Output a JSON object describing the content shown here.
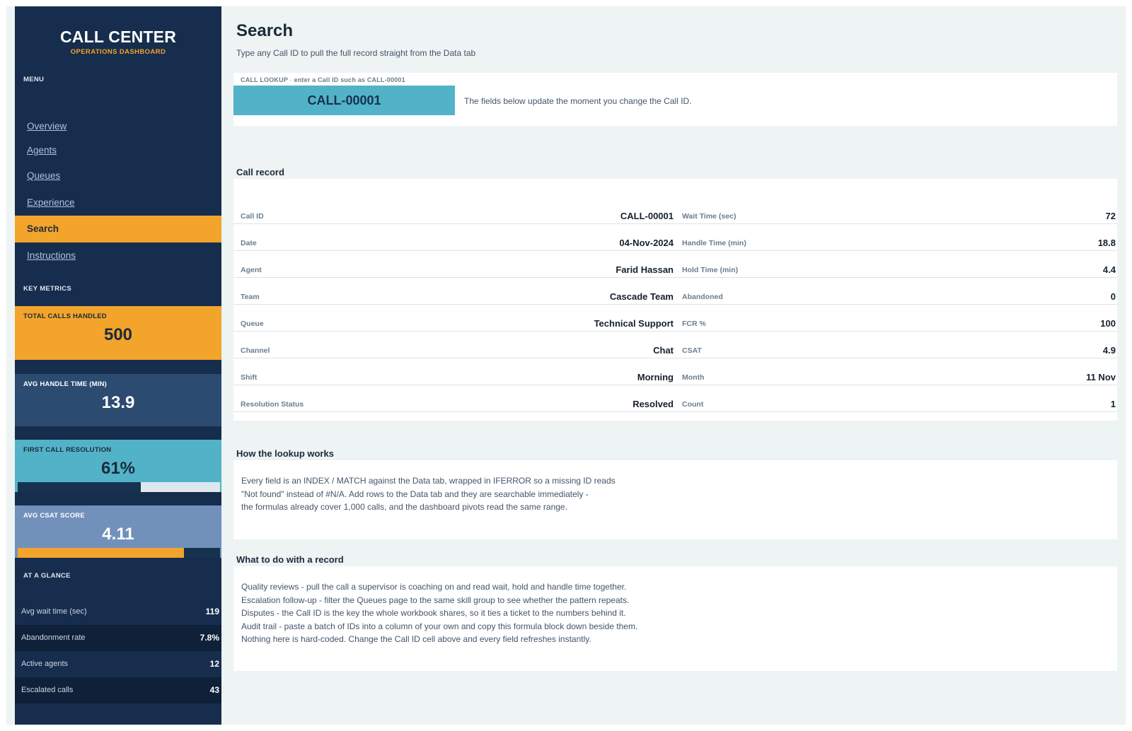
{
  "sidebar": {
    "title": "CALL CENTER",
    "subtitle": "OPERATIONS DASHBOARD",
    "menu_label": "MENU",
    "nav": [
      {
        "label": "Overview",
        "active": false
      },
      {
        "label": "Agents",
        "active": false
      },
      {
        "label": "Queues",
        "active": false
      },
      {
        "label": "Experience",
        "active": false
      },
      {
        "label": "Search",
        "active": true
      },
      {
        "label": "Instructions",
        "active": false
      }
    ],
    "metrics_label": "KEY METRICS",
    "metrics": [
      {
        "label": "TOTAL CALLS HANDLED",
        "value": "500"
      },
      {
        "label": "AVG HANDLE TIME (MIN)",
        "value": "13.9"
      },
      {
        "label": "FIRST CALL RESOLUTION",
        "value": "61%",
        "fraction": 0.61
      },
      {
        "label": "AVG CSAT SCORE",
        "value": "4.11",
        "fraction": 0.822
      }
    ],
    "glance_label": "AT A GLANCE",
    "glance": [
      {
        "label": "Avg wait time (sec)",
        "value": "119"
      },
      {
        "label": "Abandonment rate",
        "value": "7.8%"
      },
      {
        "label": "Active agents",
        "value": "12"
      },
      {
        "label": "Escalated calls",
        "value": "43"
      }
    ]
  },
  "main": {
    "title": "Search",
    "subtitle": "Type any Call ID to pull the full record straight from the Data tab",
    "lookup": {
      "label": "CALL LOOKUP",
      "separator": "·",
      "hint": "enter a Call ID such as CALL-00001",
      "value": "CALL-00001",
      "note": "The fields below update the moment you change the Call ID."
    },
    "record_title": "Call record",
    "record_left": [
      {
        "label": "Call ID",
        "value": "CALL-00001"
      },
      {
        "label": "Date",
        "value": "04-Nov-2024"
      },
      {
        "label": "Agent",
        "value": "Farid Hassan"
      },
      {
        "label": "Team",
        "value": "Cascade Team"
      },
      {
        "label": "Queue",
        "value": "Technical Support"
      },
      {
        "label": "Channel",
        "value": "Chat"
      },
      {
        "label": "Shift",
        "value": "Morning"
      },
      {
        "label": "Resolution Status",
        "value": "Resolved"
      }
    ],
    "record_right": [
      {
        "label": "Wait Time (sec)",
        "value": "72"
      },
      {
        "label": "Handle Time (min)",
        "value": "18.8"
      },
      {
        "label": "Hold Time (min)",
        "value": "4.4"
      },
      {
        "label": "Abandoned",
        "value": "0"
      },
      {
        "label": "FCR %",
        "value": "100"
      },
      {
        "label": "CSAT",
        "value": "4.9"
      },
      {
        "label": "Month",
        "value": "11 Nov"
      },
      {
        "label": "Count",
        "value": "1"
      }
    ],
    "how_title": "How the lookup works",
    "how_lines": [
      "Every field is an INDEX / MATCH against the Data tab, wrapped in IFERROR so a missing ID reads",
      "\"Not found\" instead of #N/A. Add rows to the Data tab and they are searchable immediately -",
      "the formulas already cover 1,000 calls, and the dashboard pivots read the same range."
    ],
    "what_title": "What to do with a record",
    "what_lines": [
      "Quality reviews - pull the call a supervisor is coaching on and read wait, hold and handle time together.",
      "Escalation follow-up - filter the Queues page to the same skill group to see whether the pattern repeats.",
      "Disputes - the Call ID is the key the whole workbook shares, so it ties a ticket to the numbers behind it.",
      "Audit trail - paste a batch of IDs into a column of your own and copy this formula block down beside them.",
      "Nothing here is hard-coded. Change the Call ID cell above and every field refreshes instantly."
    ]
  }
}
